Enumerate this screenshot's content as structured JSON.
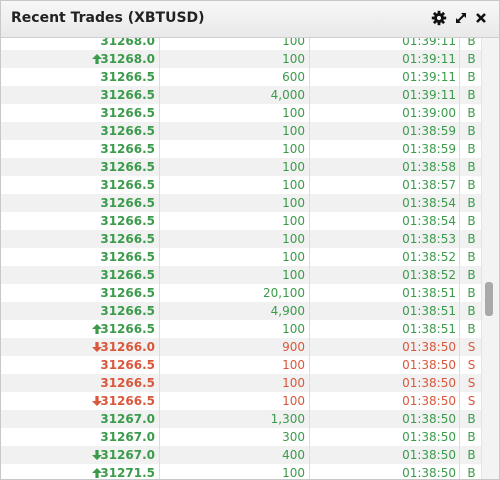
{
  "widget": {
    "title": "Recent Trades (XBTUSD)",
    "icons": [
      "gear-icon",
      "expand-icon",
      "close-icon"
    ]
  },
  "colors": {
    "buy": "#3b9b4b",
    "sell": "#d9573b"
  },
  "scroll_progress": 0.6,
  "trades": [
    {
      "price": "31268.0",
      "size": "100",
      "time": "01:39:11",
      "side": "B",
      "tick": "",
      "clipped": "top"
    },
    {
      "price": "31268.0",
      "size": "100",
      "time": "01:39:11",
      "side": "B",
      "tick": "up"
    },
    {
      "price": "31266.5",
      "size": "600",
      "time": "01:39:11",
      "side": "B",
      "tick": ""
    },
    {
      "price": "31266.5",
      "size": "4,000",
      "time": "01:39:11",
      "side": "B",
      "tick": ""
    },
    {
      "price": "31266.5",
      "size": "100",
      "time": "01:39:00",
      "side": "B",
      "tick": ""
    },
    {
      "price": "31266.5",
      "size": "100",
      "time": "01:38:59",
      "side": "B",
      "tick": ""
    },
    {
      "price": "31266.5",
      "size": "100",
      "time": "01:38:59",
      "side": "B",
      "tick": ""
    },
    {
      "price": "31266.5",
      "size": "100",
      "time": "01:38:58",
      "side": "B",
      "tick": ""
    },
    {
      "price": "31266.5",
      "size": "100",
      "time": "01:38:57",
      "side": "B",
      "tick": ""
    },
    {
      "price": "31266.5",
      "size": "100",
      "time": "01:38:54",
      "side": "B",
      "tick": ""
    },
    {
      "price": "31266.5",
      "size": "100",
      "time": "01:38:54",
      "side": "B",
      "tick": ""
    },
    {
      "price": "31266.5",
      "size": "100",
      "time": "01:38:53",
      "side": "B",
      "tick": ""
    },
    {
      "price": "31266.5",
      "size": "100",
      "time": "01:38:52",
      "side": "B",
      "tick": ""
    },
    {
      "price": "31266.5",
      "size": "100",
      "time": "01:38:52",
      "side": "B",
      "tick": ""
    },
    {
      "price": "31266.5",
      "size": "20,100",
      "time": "01:38:51",
      "side": "B",
      "tick": ""
    },
    {
      "price": "31266.5",
      "size": "4,900",
      "time": "01:38:51",
      "side": "B",
      "tick": ""
    },
    {
      "price": "31266.5",
      "size": "100",
      "time": "01:38:51",
      "side": "B",
      "tick": "up"
    },
    {
      "price": "31266.0",
      "size": "900",
      "time": "01:38:50",
      "side": "S",
      "tick": "down"
    },
    {
      "price": "31266.5",
      "size": "100",
      "time": "01:38:50",
      "side": "S",
      "tick": ""
    },
    {
      "price": "31266.5",
      "size": "100",
      "time": "01:38:50",
      "side": "S",
      "tick": ""
    },
    {
      "price": "31266.5",
      "size": "100",
      "time": "01:38:50",
      "side": "S",
      "tick": "down"
    },
    {
      "price": "31267.0",
      "size": "1,300",
      "time": "01:38:50",
      "side": "B",
      "tick": ""
    },
    {
      "price": "31267.0",
      "size": "300",
      "time": "01:38:50",
      "side": "B",
      "tick": ""
    },
    {
      "price": "31267.0",
      "size": "400",
      "time": "01:38:50",
      "side": "B",
      "tick": "down"
    },
    {
      "price": "31271.5",
      "size": "100",
      "time": "01:38:50",
      "side": "B",
      "tick": "up",
      "clipped": "bottom"
    }
  ]
}
